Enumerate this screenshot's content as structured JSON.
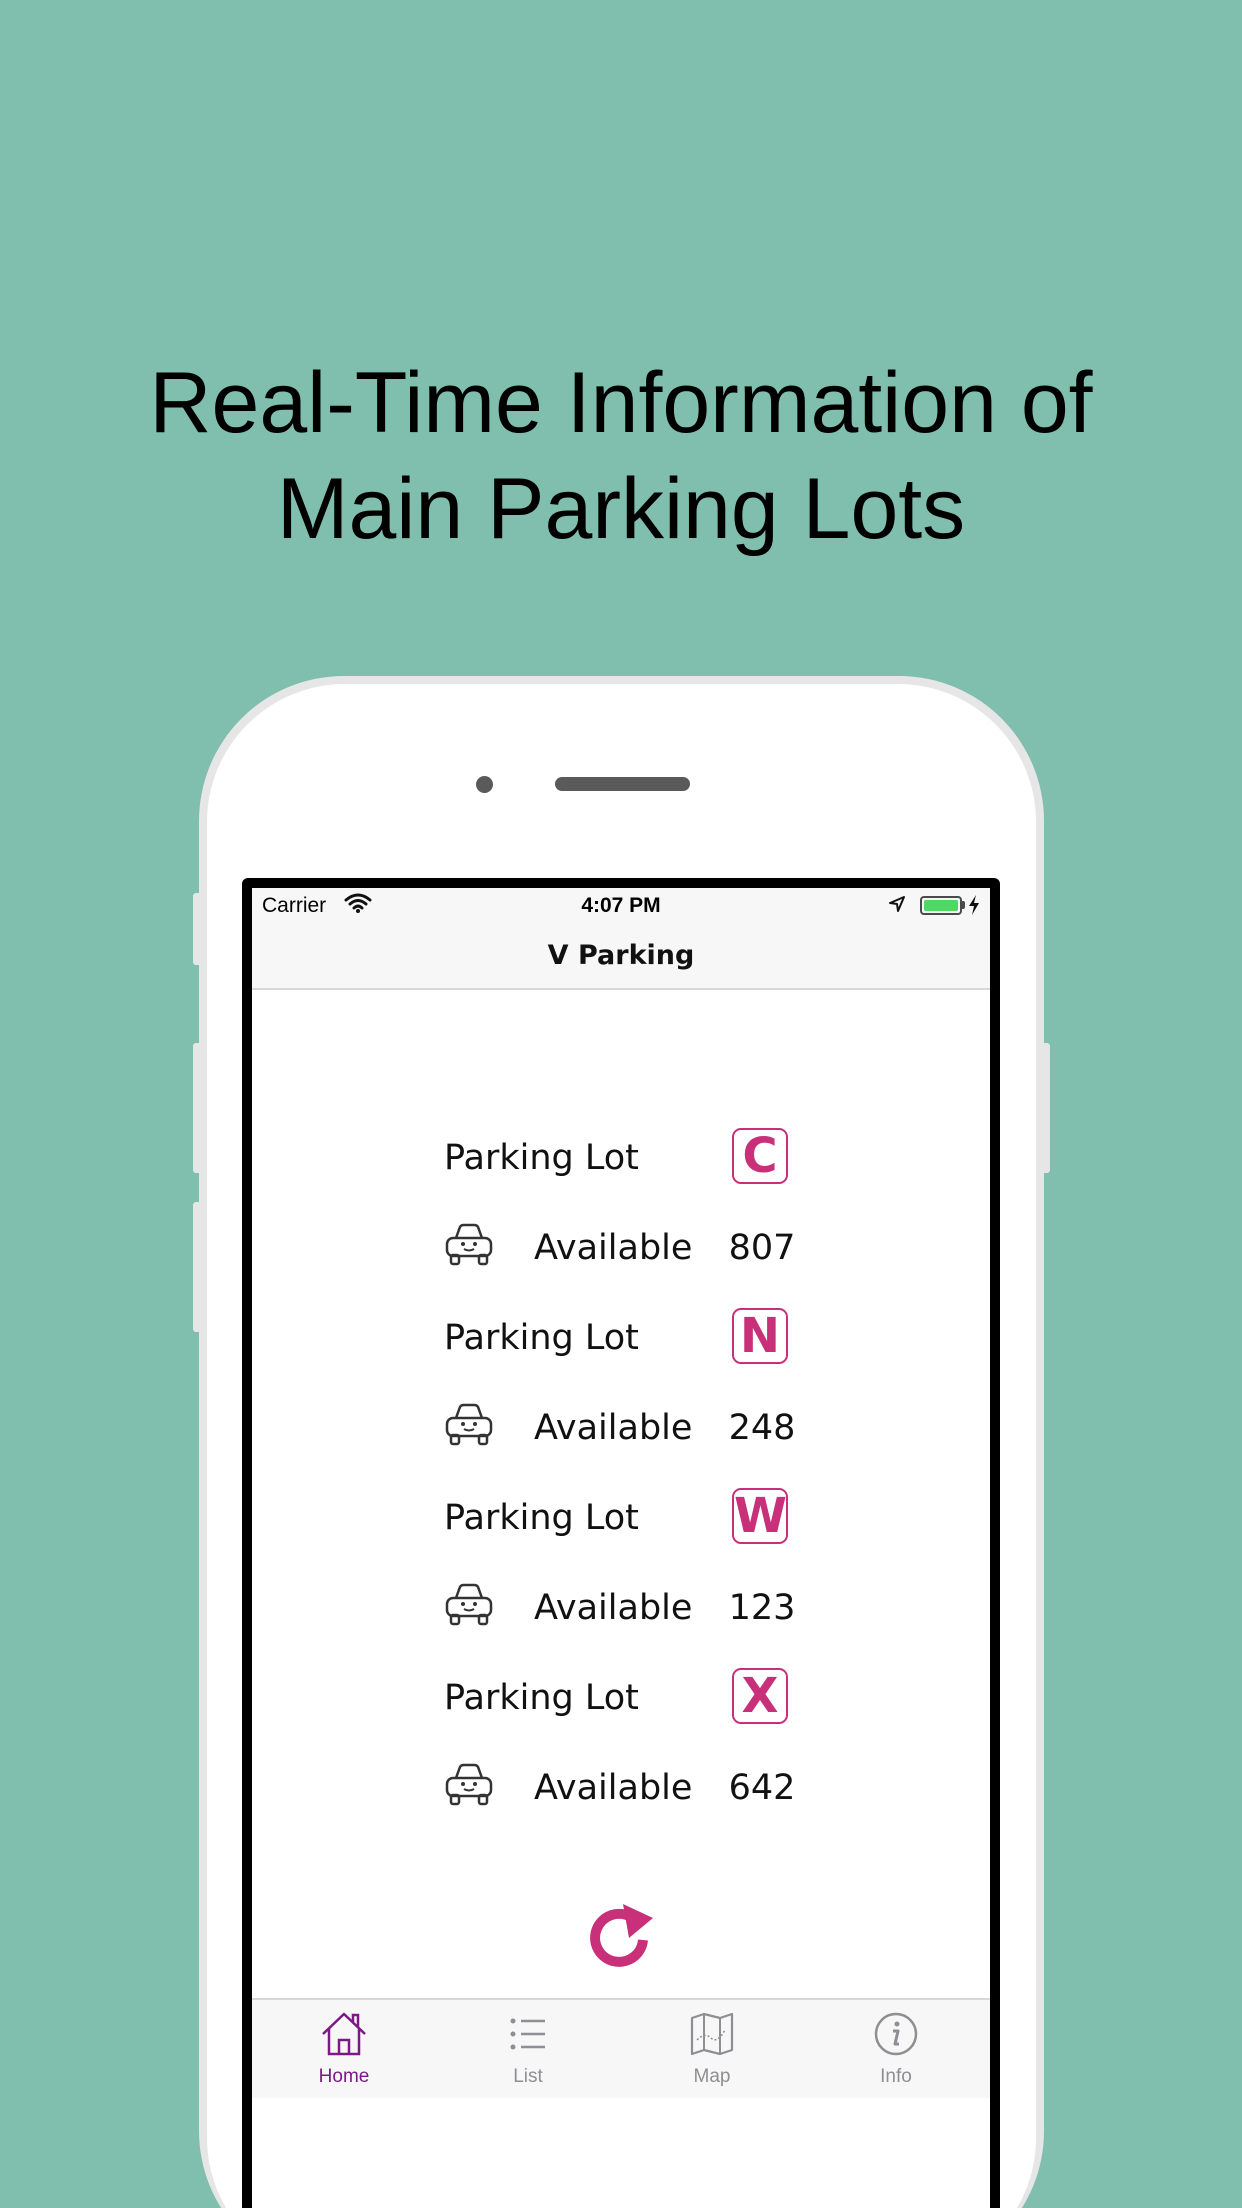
{
  "headline": {
    "line1": "Real-Time Information of",
    "line2": "Main Parking Lots"
  },
  "status_bar": {
    "carrier": "Carrier",
    "time": "4:07 PM"
  },
  "nav": {
    "title": "V Parking"
  },
  "lots": [
    {
      "label": "Parking Lot",
      "code": "C",
      "available_label": "Available",
      "available": "807"
    },
    {
      "label": "Parking Lot",
      "code": "N",
      "available_label": "Available",
      "available": "248"
    },
    {
      "label": "Parking Lot",
      "code": "W",
      "available_label": "Available",
      "available": "123"
    },
    {
      "label": "Parking Lot",
      "code": "X",
      "available_label": "Available",
      "available": "642"
    }
  ],
  "tabs": [
    {
      "label": "Home",
      "icon": "home-icon",
      "active": true
    },
    {
      "label": "List",
      "icon": "list-icon",
      "active": false
    },
    {
      "label": "Map",
      "icon": "map-icon",
      "active": false
    },
    {
      "label": "Info",
      "icon": "info-icon",
      "active": false
    }
  ],
  "colors": {
    "background": "#80beae",
    "accent": "#c8307a",
    "tab_active": "#7b1a85",
    "tab_inactive": "#8e8e93"
  }
}
